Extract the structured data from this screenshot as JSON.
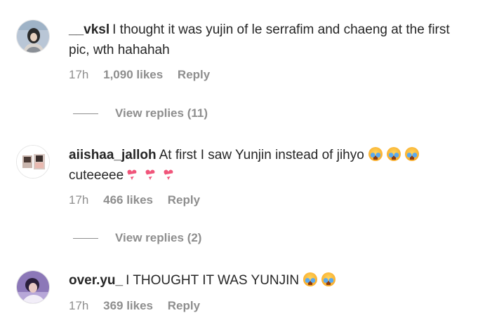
{
  "comments": [
    {
      "username": "__vksl",
      "text": "I thought it was yujin of le serrafim and chaeng at the first pic, wth hahahah",
      "time": "17h",
      "likes": "1,090 likes",
      "reply_label": "Reply",
      "view_replies": "View replies (11)",
      "emojis_inline": [],
      "emojis_line2": []
    },
    {
      "username": "aiishaa_jalloh",
      "text": "At first I saw Yunjin instead of jihyo",
      "text_line2": "cuteeeee",
      "time": "17h",
      "likes": "466 likes",
      "reply_label": "Reply",
      "view_replies": "View replies (2)",
      "emojis_inline": [
        "loudly-crying-face-icon",
        "loudly-crying-face-icon",
        "loudly-crying-face-icon"
      ],
      "emojis_line2": [
        "heart-with-ribbon-icon",
        "heart-with-ribbon-icon",
        "heart-with-ribbon-icon"
      ]
    },
    {
      "username": "over.yu_",
      "text": "I THOUGHT IT WAS YUNJIN",
      "time": "17h",
      "likes": "369 likes",
      "reply_label": "Reply",
      "emojis_inline": [
        "loudly-crying-face-icon",
        "loudly-crying-face-icon"
      ],
      "emojis_line2": []
    }
  ],
  "colors": {
    "text": "#262626",
    "secondary": "#8e8e8e",
    "background": "#ffffff"
  }
}
